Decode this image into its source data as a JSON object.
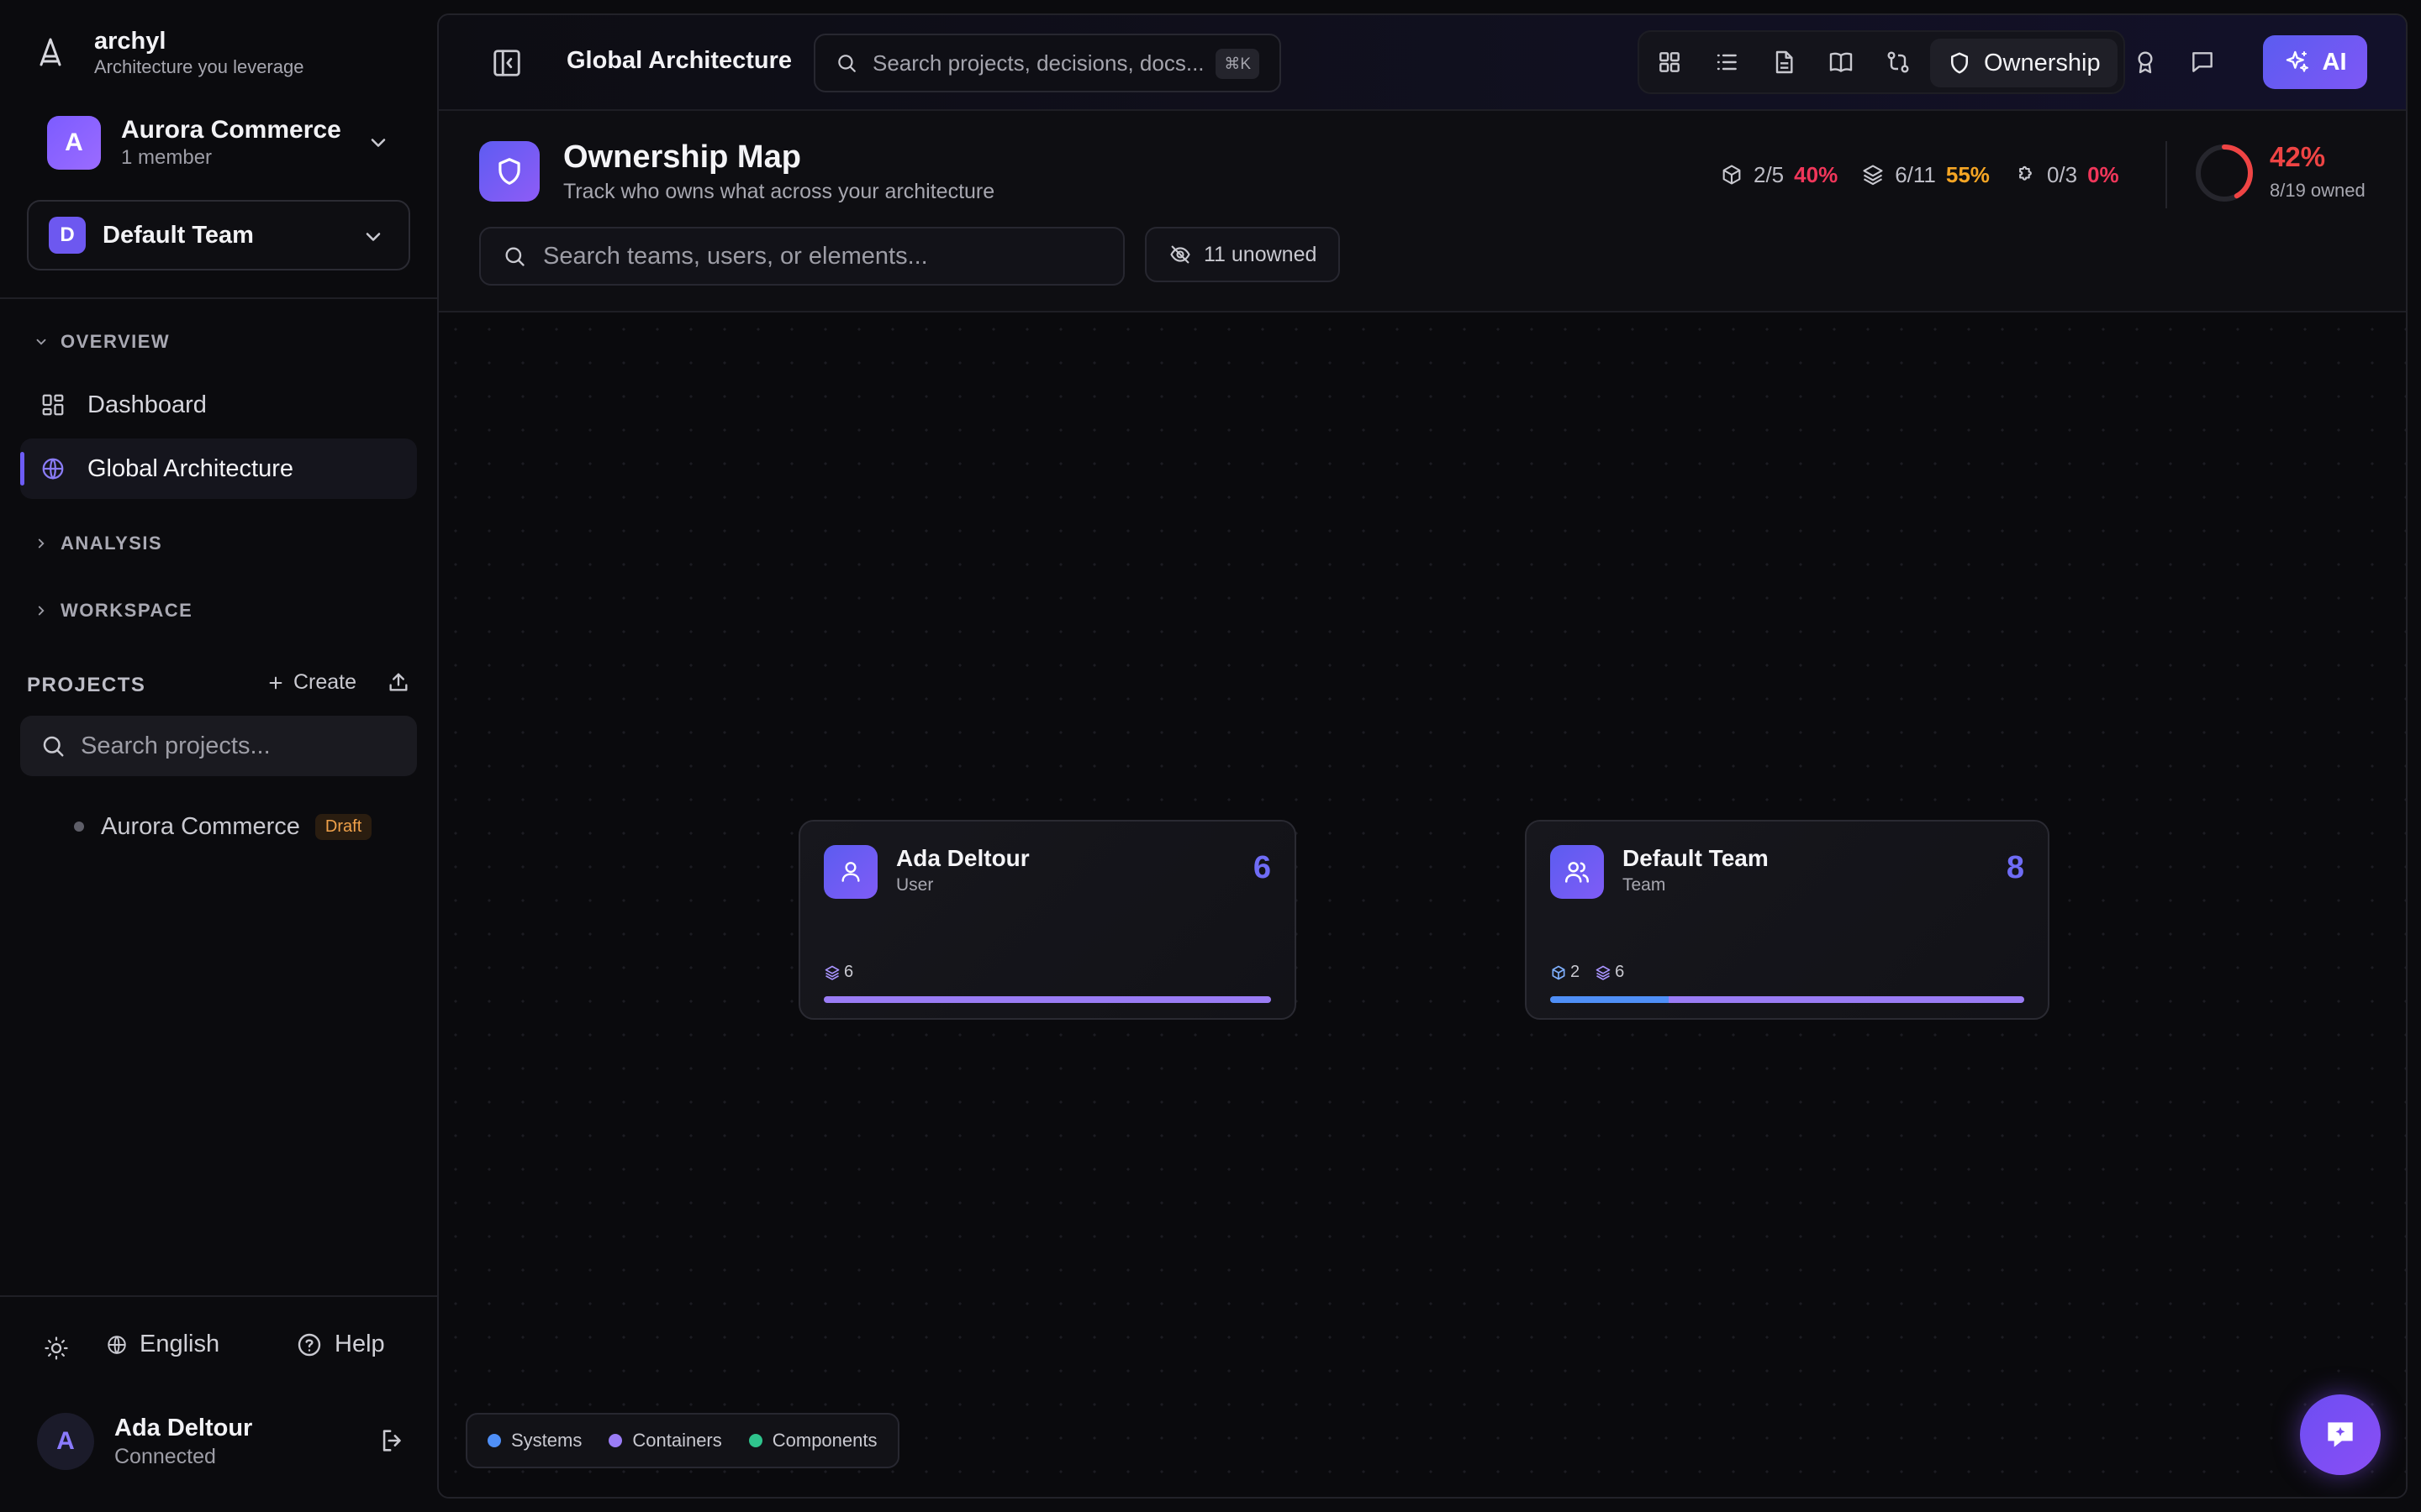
{
  "brand": {
    "name": "archyl",
    "tagline": "Architecture you leverage"
  },
  "organization": {
    "initial": "A",
    "name": "Aurora Commerce",
    "members": "1 member"
  },
  "team": {
    "initial": "D",
    "name": "Default Team"
  },
  "nav": {
    "overview_label": "OVERVIEW",
    "items": [
      {
        "label": "Dashboard",
        "icon": "dashboard-icon"
      },
      {
        "label": "Global Architecture",
        "icon": "globe-icon",
        "active": true
      }
    ],
    "analysis_label": "ANALYSIS",
    "workspace_label": "WORKSPACE"
  },
  "projects": {
    "title": "PROJECTS",
    "create_label": "Create",
    "search_placeholder": "Search projects...",
    "items": [
      {
        "name": "Aurora Commerce",
        "badge": "Draft"
      }
    ]
  },
  "footer": {
    "language": "English",
    "help": "Help"
  },
  "user": {
    "initial": "A",
    "name": "Ada Deltour",
    "status": "Connected"
  },
  "topbar": {
    "title": "Global Architecture",
    "search_placeholder": "Search projects, decisions, docs...",
    "shortcut": "⌘K",
    "active_view": "Ownership",
    "ai_label": "AI"
  },
  "header": {
    "title": "Ownership Map",
    "subtitle": "Track who owns what across your architecture",
    "stats": [
      {
        "icon": "cube-icon",
        "fraction": "2/5",
        "percent": "40%",
        "color": "#f0365a"
      },
      {
        "icon": "layers-icon",
        "fraction": "6/11",
        "percent": "55%",
        "color": "#f5a524"
      },
      {
        "icon": "puzzle-icon",
        "fraction": "0/3",
        "percent": "0%",
        "color": "#f0365a"
      }
    ],
    "owned_percent": "42%",
    "owned_label": "8/19 owned",
    "owned_fraction": 0.42,
    "search_placeholder": "Search teams, users, or elements...",
    "unowned_label": "11 unowned"
  },
  "cards": [
    {
      "name": "Ada Deltour",
      "kind": "User",
      "count": "6",
      "systems": null,
      "containers": "6"
    },
    {
      "name": "Default Team",
      "kind": "Team",
      "count": "8",
      "systems": "2",
      "containers": "6"
    }
  ],
  "legend": [
    {
      "label": "Systems",
      "color": "#4f8ff7"
    },
    {
      "label": "Containers",
      "color": "#9a7cf5"
    },
    {
      "label": "Components",
      "color": "#2fc48d"
    }
  ]
}
